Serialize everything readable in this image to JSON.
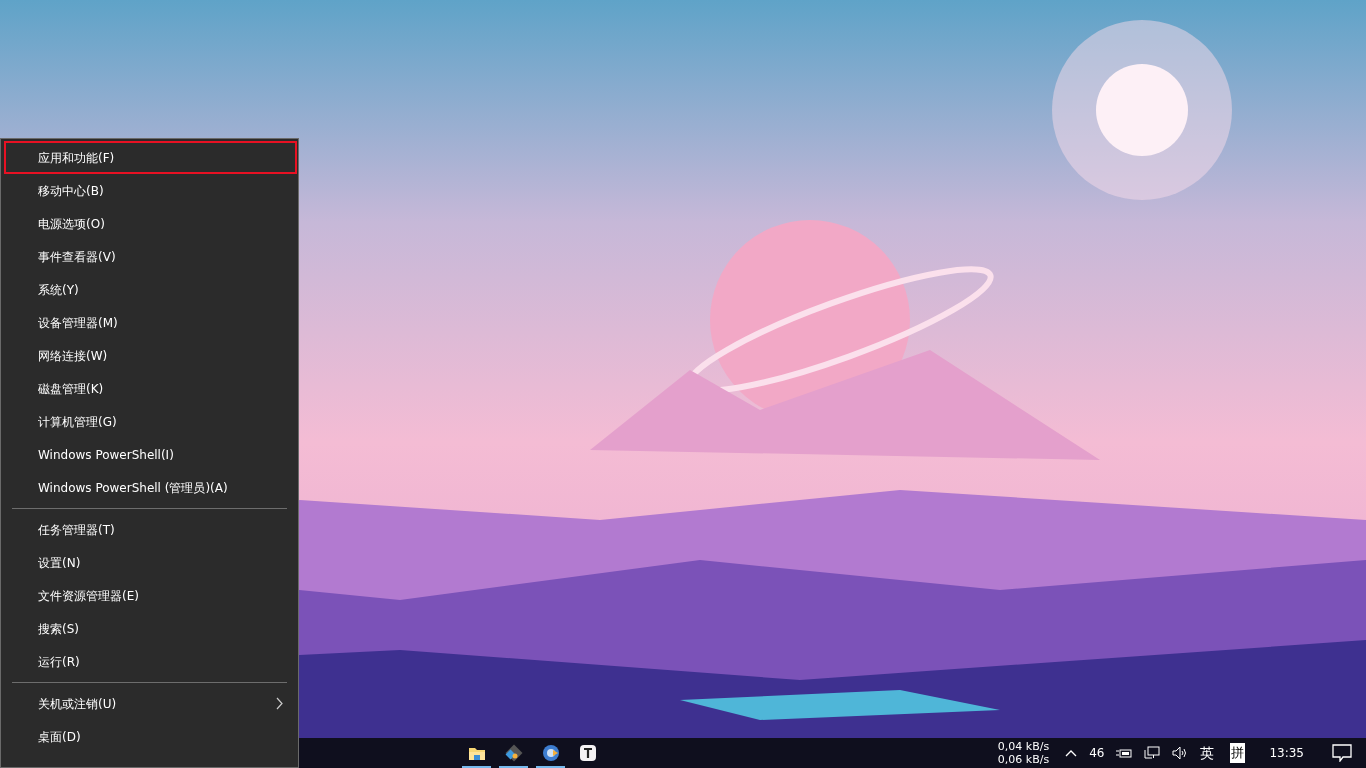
{
  "context_menu": {
    "groups": [
      {
        "items": [
          {
            "label": "应用和功能(F)",
            "selected": true,
            "submenu": false
          },
          {
            "label": "移动中心(B)",
            "selected": false,
            "submenu": false
          },
          {
            "label": "电源选项(O)",
            "selected": false,
            "submenu": false
          },
          {
            "label": "事件查看器(V)",
            "selected": false,
            "submenu": false
          },
          {
            "label": "系统(Y)",
            "selected": false,
            "submenu": false
          },
          {
            "label": "设备管理器(M)",
            "selected": false,
            "submenu": false
          },
          {
            "label": "网络连接(W)",
            "selected": false,
            "submenu": false
          },
          {
            "label": "磁盘管理(K)",
            "selected": false,
            "submenu": false
          },
          {
            "label": "计算机管理(G)",
            "selected": false,
            "submenu": false
          },
          {
            "label": "Windows PowerShell(I)",
            "selected": false,
            "submenu": false
          },
          {
            "label": "Windows PowerShell (管理员)(A)",
            "selected": false,
            "submenu": false
          }
        ]
      },
      {
        "items": [
          {
            "label": "任务管理器(T)",
            "selected": false,
            "submenu": false
          },
          {
            "label": "设置(N)",
            "selected": false,
            "submenu": false
          },
          {
            "label": "文件资源管理器(E)",
            "selected": false,
            "submenu": false
          },
          {
            "label": "搜索(S)",
            "selected": false,
            "submenu": false
          },
          {
            "label": "运行(R)",
            "selected": false,
            "submenu": false
          }
        ]
      },
      {
        "items": [
          {
            "label": "关机或注销(U)",
            "selected": false,
            "submenu": true
          },
          {
            "label": "桌面(D)",
            "selected": false,
            "submenu": false
          }
        ]
      }
    ]
  },
  "taskbar": {
    "apps": [
      {
        "kind": "folder",
        "running": true
      },
      {
        "kind": "git",
        "running": true
      },
      {
        "kind": "browser",
        "running": true
      },
      {
        "kind": "typora",
        "running": false
      }
    ],
    "tray": {
      "net_up": "0,04 kB/s",
      "net_down": "0,06 kB/s",
      "temperature": "46",
      "language": "英",
      "ime": "拼",
      "time": "13:35"
    }
  }
}
